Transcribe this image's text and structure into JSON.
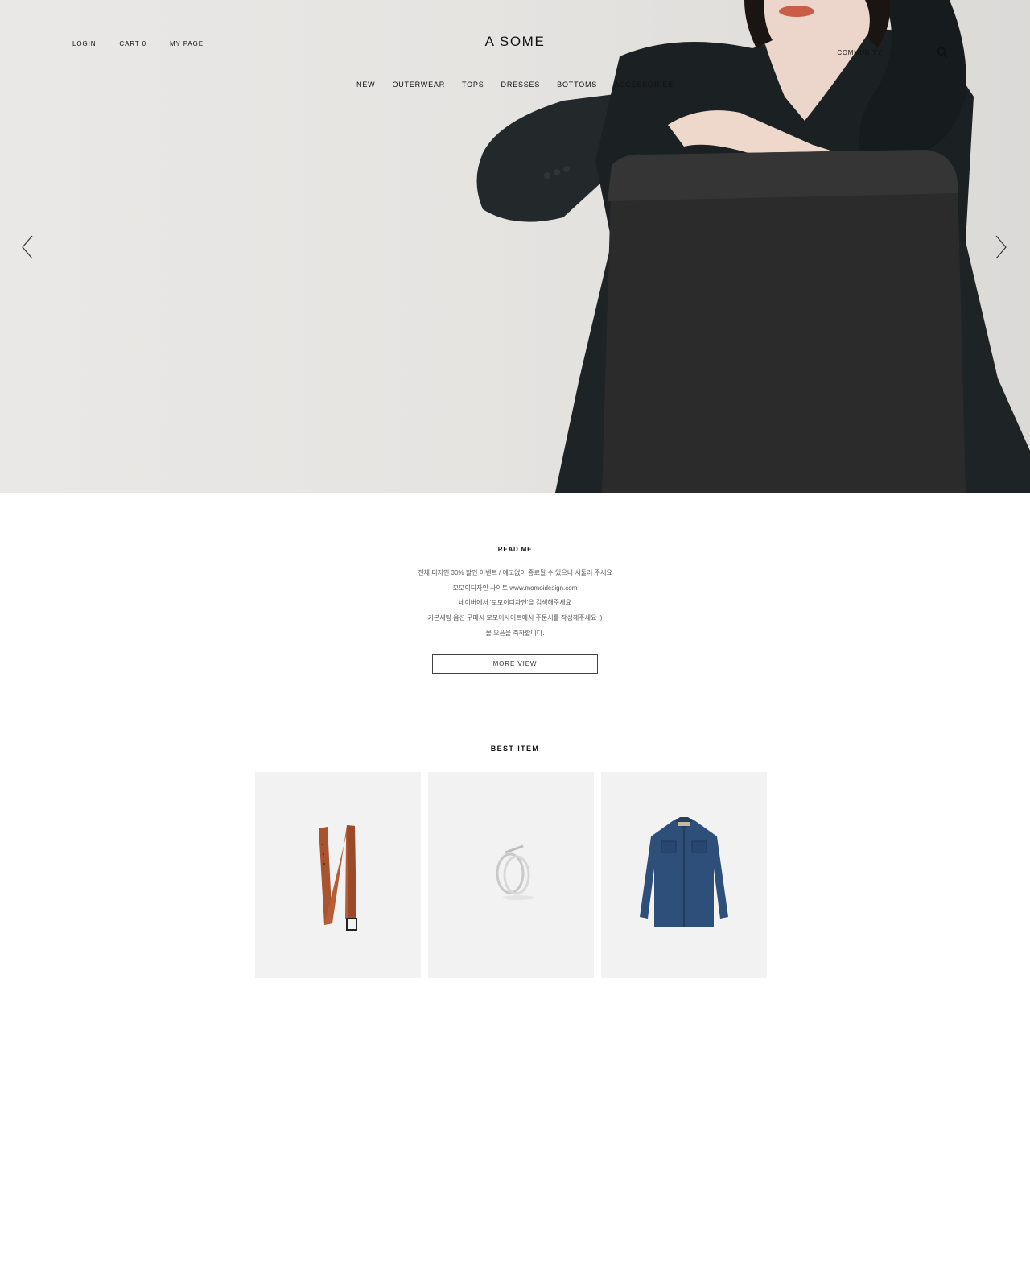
{
  "brand": {
    "name": "A SOME"
  },
  "top_links": {
    "login": "LOGIN",
    "cart": "CART 0",
    "mypage": "MY PAGE"
  },
  "utility_links": {
    "community": "COMMUNITY",
    "second": ""
  },
  "nav": {
    "items": [
      {
        "label": "NEW"
      },
      {
        "label": "OUTERWEAR"
      },
      {
        "label": "TOPS"
      },
      {
        "label": "DRESSES"
      },
      {
        "label": "BOTTOMS"
      },
      {
        "label": "ACCESSORIES"
      }
    ]
  },
  "hero": {
    "prev_icon": "chevron-left-icon",
    "next_icon": "chevron-right-icon"
  },
  "readme": {
    "title": "READ ME",
    "lines": [
      "전체 디자인 30% 할인 이벤트 / 예고없이 종료될 수 있으니 서둘러 주세요",
      "모모이디자인 사이트 www.momoidesign.com",
      "네이버에서 '모모이디자인'을 검색해주세요",
      "기본세팅 옵션 구매시 모모이사이트에서 주문서를 작성해주세요 :)",
      "몰 오픈을 축하합니다."
    ],
    "button": "MORE VIEW"
  },
  "best": {
    "title": "BEST ITEM",
    "items": [
      {
        "image": "brown-leather-belt"
      },
      {
        "image": "silver-wrap-ring"
      },
      {
        "image": "denim-shirt"
      }
    ]
  }
}
